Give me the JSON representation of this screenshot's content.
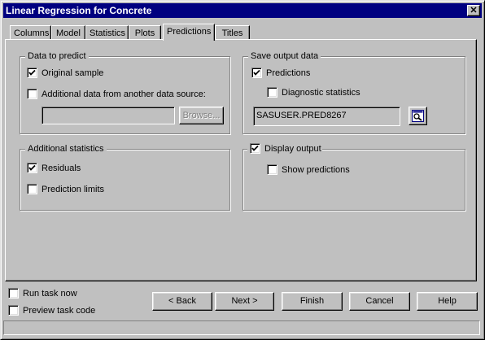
{
  "window": {
    "title": "Linear Regression for Concrete",
    "close_label": "✕"
  },
  "tabs": [
    {
      "label": "Columns"
    },
    {
      "label": "Model"
    },
    {
      "label": "Statistics"
    },
    {
      "label": "Plots"
    },
    {
      "label": "Predictions",
      "active": true
    },
    {
      "label": "Titles"
    }
  ],
  "data_to_predict": {
    "legend": "Data to predict",
    "original_sample": {
      "label": "Original sample",
      "checked": true
    },
    "additional_data": {
      "label": "Additional data from another data source:",
      "checked": false
    },
    "data_source_value": "",
    "browse_label": "Browse..."
  },
  "save_output": {
    "legend": "Save output data",
    "predictions": {
      "label": "Predictions",
      "checked": true
    },
    "diagnostic": {
      "label": "Diagnostic statistics",
      "checked": false
    },
    "dataset_value": "SASUSER.PRED8267",
    "browse_icon": "magnifier-icon"
  },
  "additional_statistics": {
    "legend": "Additional statistics",
    "residuals": {
      "label": "Residuals",
      "checked": true
    },
    "prediction_limits": {
      "label": "Prediction limits",
      "checked": false
    }
  },
  "display_output": {
    "label": "Display output",
    "checked": true,
    "show_predictions": {
      "label": "Show predictions",
      "checked": false
    }
  },
  "footer": {
    "run_task_now": {
      "label": "Run task now",
      "checked": false
    },
    "preview_task_code": {
      "label": "Preview task code",
      "checked": false
    },
    "back_label": "< Back",
    "next_label": "Next >",
    "finish_label": "Finish",
    "cancel_label": "Cancel",
    "help_label": "Help"
  }
}
